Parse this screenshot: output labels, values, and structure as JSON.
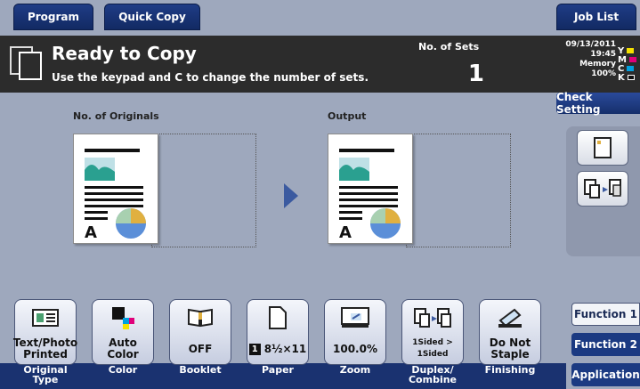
{
  "tabs": {
    "program": "Program",
    "quick_copy": "Quick Copy",
    "job_list": "Job List"
  },
  "status": {
    "title": "Ready to Copy",
    "subtitle": "Use the keypad and C to change the number of sets.",
    "sets_label": "No. of Sets",
    "sets_value": "1",
    "date": "09/13/2011",
    "time": "19:45",
    "memory_label": "Memory",
    "memory_value": "100%",
    "toner": [
      {
        "letter": "Y",
        "color": "#f5e100"
      },
      {
        "letter": "M",
        "color": "#e0007a"
      },
      {
        "letter": "C",
        "color": "#00a0e0"
      },
      {
        "letter": "K",
        "color": "#222222"
      }
    ]
  },
  "check_setting": "Check Setting",
  "preview": {
    "originals_label": "No. of Originals",
    "output_label": "Output"
  },
  "functions": [
    {
      "value": "Text/Photo\nPrinted",
      "caption": "Original Type"
    },
    {
      "value": "Auto Color",
      "caption": "Color"
    },
    {
      "value": "OFF",
      "caption": "Booklet"
    },
    {
      "value": "8½×11",
      "caption": "Paper",
      "tray": "1"
    },
    {
      "value": "100.0%",
      "caption": "Zoom"
    },
    {
      "value": "1Sided > 1Sided",
      "caption": "Duplex/\nCombine"
    },
    {
      "value": "Do Not\nStaple",
      "caption": "Finishing"
    }
  ],
  "side_tabs": {
    "function1": "Function 1",
    "function2": "Function 2",
    "application": "Application"
  }
}
